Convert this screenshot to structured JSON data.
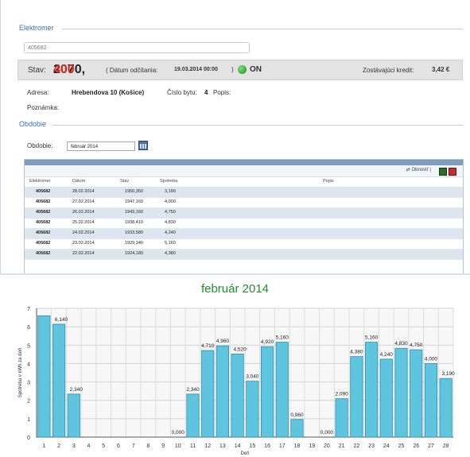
{
  "meter": {
    "legend": "Elektromer",
    "id_value": "405682",
    "stav_label": "Stav:",
    "stav_main": "2070,",
    "stav_decimals": "400",
    "reading_date_label": "( Dátum odčítania:",
    "reading_date": "19.03.2014 00:00",
    "reading_date_close": ")",
    "status": "ON",
    "status_color": "#1b8c1b",
    "credit_label": "Zostávajúci kredit:",
    "credit_value": "3,42 €",
    "address_label": "Adresa:",
    "address_value": "Hrebendova 10 (Košice)",
    "flat_label": "Číslo bytu:",
    "flat_value": "4",
    "desc_label": "Popis:",
    "note_label": "Poznámka:"
  },
  "period": {
    "legend": "Obdobie",
    "label": "Obdobie:",
    "selected": "február 2014"
  },
  "table": {
    "refresh_label": "Obnoviť",
    "columns": [
      "Elektromer",
      "Dátum",
      "Stav",
      "Spotreba",
      "Popis"
    ],
    "rows": [
      [
        "405682",
        "28.02.2014",
        "1950,350",
        "3,190",
        ""
      ],
      [
        "405682",
        "27.02.2014",
        "1947,160",
        "4,000",
        ""
      ],
      [
        "405682",
        "26.02.2014",
        "1943,160",
        "4,750",
        ""
      ],
      [
        "405682",
        "25.02.2014",
        "1938,410",
        "4,830",
        ""
      ],
      [
        "405682",
        "24.02.2014",
        "1933,580",
        "4,240",
        ""
      ],
      [
        "405682",
        "23.02.2014",
        "1929,340",
        "5,160",
        ""
      ],
      [
        "405682",
        "22.02.2014",
        "1924,180",
        "4,380",
        ""
      ]
    ]
  },
  "chart_data": {
    "type": "bar",
    "title": "február 2014",
    "ylabel": "Spotreba v kWh za deň",
    "xlabel": "Deň",
    "ylim": [
      0,
      7
    ],
    "yticks": [
      0,
      1,
      2,
      3,
      4,
      5,
      6,
      7
    ],
    "categories": [
      "1",
      "2",
      "3",
      "4",
      "5",
      "6",
      "7",
      "8",
      "9",
      "10",
      "11",
      "12",
      "13",
      "14",
      "15",
      "16",
      "17",
      "18",
      "19",
      "20",
      "21",
      "22",
      "23",
      "24",
      "25",
      "26",
      "27",
      "28"
    ],
    "values": [
      6.6,
      6.14,
      2.34,
      null,
      null,
      null,
      null,
      null,
      null,
      0.0,
      2.34,
      4.71,
      4.96,
      4.52,
      3.04,
      4.92,
      5.16,
      0.96,
      null,
      0.0,
      2.09,
      4.38,
      5.16,
      4.24,
      4.83,
      4.75,
      4.0,
      3.19
    ],
    "data_labels": [
      "",
      "6,140",
      "2,340",
      "",
      "",
      "",
      "",
      "",
      "",
      "0,000",
      "2,340",
      "4,710",
      "4,960",
      "4,520",
      "3,040",
      "4,920",
      "5,160",
      "0,960",
      "",
      "0,000",
      "2,090",
      "4,380",
      "5,160",
      "4,240",
      "4,830",
      "4,750",
      "4,000",
      "3,190"
    ],
    "bar_color": "#5fc4de",
    "bar_edge_color": "#2f8fb0",
    "grid": true
  }
}
